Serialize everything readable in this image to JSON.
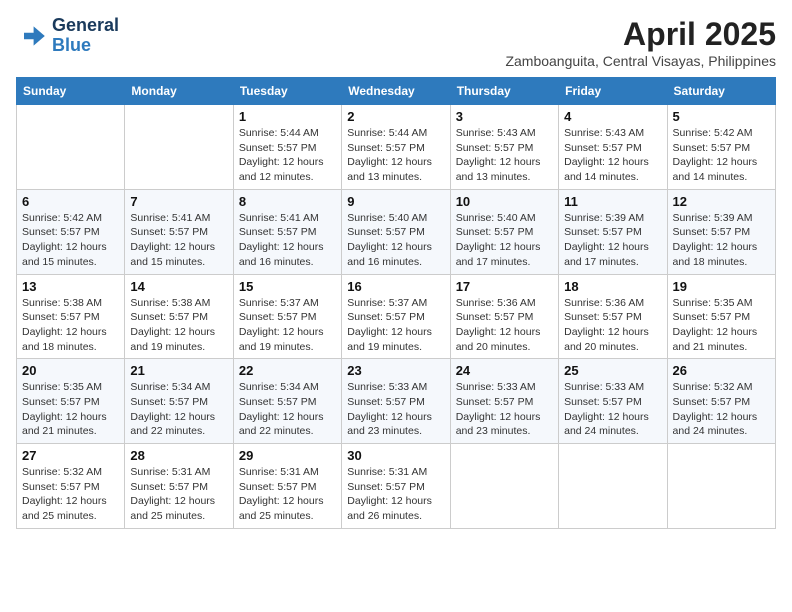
{
  "header": {
    "logo_line1": "General",
    "logo_line2": "Blue",
    "month_year": "April 2025",
    "location": "Zamboanguita, Central Visayas, Philippines"
  },
  "weekdays": [
    "Sunday",
    "Monday",
    "Tuesday",
    "Wednesday",
    "Thursday",
    "Friday",
    "Saturday"
  ],
  "weeks": [
    [
      {
        "day": "",
        "sunrise": "",
        "sunset": "",
        "daylight": ""
      },
      {
        "day": "",
        "sunrise": "",
        "sunset": "",
        "daylight": ""
      },
      {
        "day": "1",
        "sunrise": "Sunrise: 5:44 AM",
        "sunset": "Sunset: 5:57 PM",
        "daylight": "Daylight: 12 hours and 12 minutes."
      },
      {
        "day": "2",
        "sunrise": "Sunrise: 5:44 AM",
        "sunset": "Sunset: 5:57 PM",
        "daylight": "Daylight: 12 hours and 13 minutes."
      },
      {
        "day": "3",
        "sunrise": "Sunrise: 5:43 AM",
        "sunset": "Sunset: 5:57 PM",
        "daylight": "Daylight: 12 hours and 13 minutes."
      },
      {
        "day": "4",
        "sunrise": "Sunrise: 5:43 AM",
        "sunset": "Sunset: 5:57 PM",
        "daylight": "Daylight: 12 hours and 14 minutes."
      },
      {
        "day": "5",
        "sunrise": "Sunrise: 5:42 AM",
        "sunset": "Sunset: 5:57 PM",
        "daylight": "Daylight: 12 hours and 14 minutes."
      }
    ],
    [
      {
        "day": "6",
        "sunrise": "Sunrise: 5:42 AM",
        "sunset": "Sunset: 5:57 PM",
        "daylight": "Daylight: 12 hours and 15 minutes."
      },
      {
        "day": "7",
        "sunrise": "Sunrise: 5:41 AM",
        "sunset": "Sunset: 5:57 PM",
        "daylight": "Daylight: 12 hours and 15 minutes."
      },
      {
        "day": "8",
        "sunrise": "Sunrise: 5:41 AM",
        "sunset": "Sunset: 5:57 PM",
        "daylight": "Daylight: 12 hours and 16 minutes."
      },
      {
        "day": "9",
        "sunrise": "Sunrise: 5:40 AM",
        "sunset": "Sunset: 5:57 PM",
        "daylight": "Daylight: 12 hours and 16 minutes."
      },
      {
        "day": "10",
        "sunrise": "Sunrise: 5:40 AM",
        "sunset": "Sunset: 5:57 PM",
        "daylight": "Daylight: 12 hours and 17 minutes."
      },
      {
        "day": "11",
        "sunrise": "Sunrise: 5:39 AM",
        "sunset": "Sunset: 5:57 PM",
        "daylight": "Daylight: 12 hours and 17 minutes."
      },
      {
        "day": "12",
        "sunrise": "Sunrise: 5:39 AM",
        "sunset": "Sunset: 5:57 PM",
        "daylight": "Daylight: 12 hours and 18 minutes."
      }
    ],
    [
      {
        "day": "13",
        "sunrise": "Sunrise: 5:38 AM",
        "sunset": "Sunset: 5:57 PM",
        "daylight": "Daylight: 12 hours and 18 minutes."
      },
      {
        "day": "14",
        "sunrise": "Sunrise: 5:38 AM",
        "sunset": "Sunset: 5:57 PM",
        "daylight": "Daylight: 12 hours and 19 minutes."
      },
      {
        "day": "15",
        "sunrise": "Sunrise: 5:37 AM",
        "sunset": "Sunset: 5:57 PM",
        "daylight": "Daylight: 12 hours and 19 minutes."
      },
      {
        "day": "16",
        "sunrise": "Sunrise: 5:37 AM",
        "sunset": "Sunset: 5:57 PM",
        "daylight": "Daylight: 12 hours and 19 minutes."
      },
      {
        "day": "17",
        "sunrise": "Sunrise: 5:36 AM",
        "sunset": "Sunset: 5:57 PM",
        "daylight": "Daylight: 12 hours and 20 minutes."
      },
      {
        "day": "18",
        "sunrise": "Sunrise: 5:36 AM",
        "sunset": "Sunset: 5:57 PM",
        "daylight": "Daylight: 12 hours and 20 minutes."
      },
      {
        "day": "19",
        "sunrise": "Sunrise: 5:35 AM",
        "sunset": "Sunset: 5:57 PM",
        "daylight": "Daylight: 12 hours and 21 minutes."
      }
    ],
    [
      {
        "day": "20",
        "sunrise": "Sunrise: 5:35 AM",
        "sunset": "Sunset: 5:57 PM",
        "daylight": "Daylight: 12 hours and 21 minutes."
      },
      {
        "day": "21",
        "sunrise": "Sunrise: 5:34 AM",
        "sunset": "Sunset: 5:57 PM",
        "daylight": "Daylight: 12 hours and 22 minutes."
      },
      {
        "day": "22",
        "sunrise": "Sunrise: 5:34 AM",
        "sunset": "Sunset: 5:57 PM",
        "daylight": "Daylight: 12 hours and 22 minutes."
      },
      {
        "day": "23",
        "sunrise": "Sunrise: 5:33 AM",
        "sunset": "Sunset: 5:57 PM",
        "daylight": "Daylight: 12 hours and 23 minutes."
      },
      {
        "day": "24",
        "sunrise": "Sunrise: 5:33 AM",
        "sunset": "Sunset: 5:57 PM",
        "daylight": "Daylight: 12 hours and 23 minutes."
      },
      {
        "day": "25",
        "sunrise": "Sunrise: 5:33 AM",
        "sunset": "Sunset: 5:57 PM",
        "daylight": "Daylight: 12 hours and 24 minutes."
      },
      {
        "day": "26",
        "sunrise": "Sunrise: 5:32 AM",
        "sunset": "Sunset: 5:57 PM",
        "daylight": "Daylight: 12 hours and 24 minutes."
      }
    ],
    [
      {
        "day": "27",
        "sunrise": "Sunrise: 5:32 AM",
        "sunset": "Sunset: 5:57 PM",
        "daylight": "Daylight: 12 hours and 25 minutes."
      },
      {
        "day": "28",
        "sunrise": "Sunrise: 5:31 AM",
        "sunset": "Sunset: 5:57 PM",
        "daylight": "Daylight: 12 hours and 25 minutes."
      },
      {
        "day": "29",
        "sunrise": "Sunrise: 5:31 AM",
        "sunset": "Sunset: 5:57 PM",
        "daylight": "Daylight: 12 hours and 25 minutes."
      },
      {
        "day": "30",
        "sunrise": "Sunrise: 5:31 AM",
        "sunset": "Sunset: 5:57 PM",
        "daylight": "Daylight: 12 hours and 26 minutes."
      },
      {
        "day": "",
        "sunrise": "",
        "sunset": "",
        "daylight": ""
      },
      {
        "day": "",
        "sunrise": "",
        "sunset": "",
        "daylight": ""
      },
      {
        "day": "",
        "sunrise": "",
        "sunset": "",
        "daylight": ""
      }
    ]
  ]
}
